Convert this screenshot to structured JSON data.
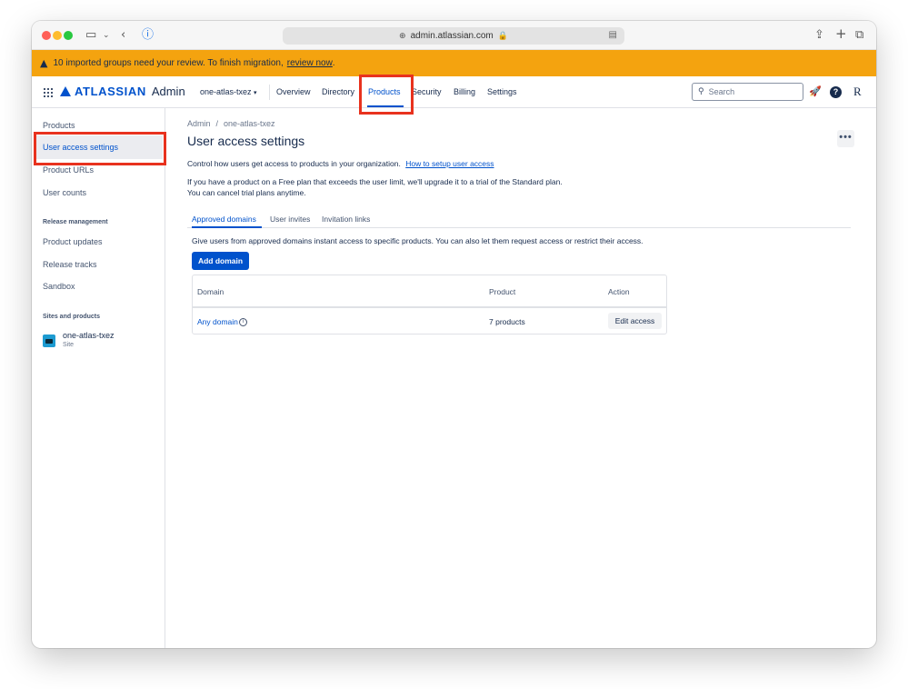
{
  "browser": {
    "url": "admin.atlassian.com"
  },
  "banner": {
    "message": "10 imported groups need your review. To finish migration,",
    "link": "review now",
    "suffix": "."
  },
  "topnav": {
    "brand": "ATLASSIAN",
    "product": "Admin",
    "org": "one-atlas-txez",
    "items": [
      {
        "label": "Overview"
      },
      {
        "label": "Directory"
      },
      {
        "label": "Products"
      },
      {
        "label": "Security"
      },
      {
        "label": "Billing"
      },
      {
        "label": "Settings"
      }
    ],
    "active_item": "Products",
    "search_placeholder": "Search",
    "avatar_initial": "R"
  },
  "sidebar": {
    "items": [
      {
        "label": "Products"
      },
      {
        "label": "User access settings"
      },
      {
        "label": "Product URLs"
      },
      {
        "label": "User counts"
      }
    ],
    "release_heading": "Release management",
    "release_items": [
      {
        "label": "Product updates"
      },
      {
        "label": "Release tracks"
      },
      {
        "label": "Sandbox"
      }
    ],
    "sites_heading": "Sites and products",
    "site": {
      "name": "one-atlas-txez",
      "type": "Site"
    }
  },
  "main": {
    "breadcrumb": [
      "Admin",
      "/",
      "one-atlas-txez"
    ],
    "title": "User access settings",
    "intro": "Control how users get access to products in your organization.",
    "intro_link": "How to setup user access",
    "note_line1": "If you have a product on a Free plan that exceeds the user limit, we'll upgrade it to a trial of the Standard plan.",
    "note_line2": "You can cancel trial plans anytime.",
    "tabs": [
      {
        "label": "Approved domains"
      },
      {
        "label": "User invites"
      },
      {
        "label": "Invitation links"
      }
    ],
    "description": "Give users from approved domains instant access to specific products. You can also let them request access or restrict their access.",
    "add_button": "Add domain",
    "table": {
      "headers": [
        "Domain",
        "Product",
        "Action"
      ],
      "rows": [
        {
          "domain": "Any domain",
          "product": "7 products",
          "action": "Edit access"
        }
      ]
    }
  },
  "colors": {
    "accent": "#0052cc",
    "banner": "#f4a30f",
    "highlight": "#e8321e"
  }
}
